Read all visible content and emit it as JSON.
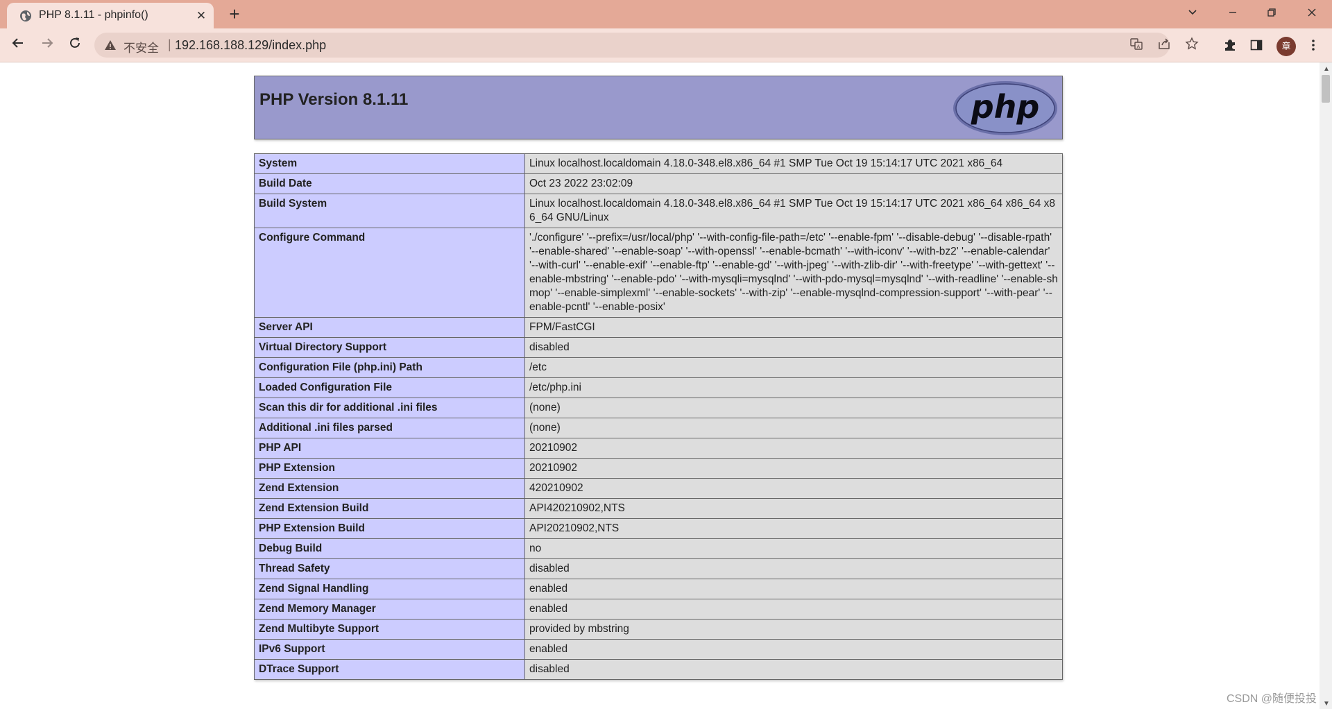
{
  "browser": {
    "tab_title": "PHP 8.1.11 - phpinfo()",
    "tab_close": "✕",
    "new_tab": "+",
    "insecure_label": "不安全",
    "separator": "|",
    "url": "192.168.188.129/index.php",
    "avatar_initial": "章",
    "icons": {
      "back": "back-arrow-icon",
      "forward": "forward-arrow-icon",
      "reload": "reload-icon",
      "translate": "translate-icon",
      "share": "share-icon",
      "bookmark": "star-icon",
      "extensions": "puzzle-icon",
      "sidebar": "sidebar-icon",
      "menu": "kebab-menu-icon"
    }
  },
  "page": {
    "title": "PHP Version 8.1.11",
    "rows": [
      {
        "key": "System",
        "value": "Linux localhost.localdomain 4.18.0-348.el8.x86_64 #1 SMP Tue Oct 19 15:14:17 UTC 2021 x86_64"
      },
      {
        "key": "Build Date",
        "value": "Oct 23 2022 23:02:09"
      },
      {
        "key": "Build System",
        "value": "Linux localhost.localdomain 4.18.0-348.el8.x86_64 #1 SMP Tue Oct 19 15:14:17 UTC 2021 x86_64 x86_64 x86_64 GNU/Linux"
      },
      {
        "key": "Configure Command",
        "value": "'./configure' '--prefix=/usr/local/php' '--with-config-file-path=/etc' '--enable-fpm' '--disable-debug' '--disable-rpath' '--enable-shared' '--enable-soap' '--with-openssl' '--enable-bcmath' '--with-iconv' '--with-bz2' '--enable-calendar' '--with-curl' '--enable-exif' '--enable-ftp' '--enable-gd' '--with-jpeg' '--with-zlib-dir' '--with-freetype' '--with-gettext' '--enable-mbstring' '--enable-pdo' '--with-mysqli=mysqlnd' '--with-pdo-mysql=mysqlnd' '--with-readline' '--enable-shmop' '--enable-simplexml' '--enable-sockets' '--with-zip' '--enable-mysqlnd-compression-support' '--with-pear' '--enable-pcntl' '--enable-posix'"
      },
      {
        "key": "Server API",
        "value": "FPM/FastCGI"
      },
      {
        "key": "Virtual Directory Support",
        "value": "disabled"
      },
      {
        "key": "Configuration File (php.ini) Path",
        "value": "/etc"
      },
      {
        "key": "Loaded Configuration File",
        "value": "/etc/php.ini"
      },
      {
        "key": "Scan this dir for additional .ini files",
        "value": "(none)"
      },
      {
        "key": "Additional .ini files parsed",
        "value": "(none)"
      },
      {
        "key": "PHP API",
        "value": "20210902"
      },
      {
        "key": "PHP Extension",
        "value": "20210902"
      },
      {
        "key": "Zend Extension",
        "value": "420210902"
      },
      {
        "key": "Zend Extension Build",
        "value": "API420210902,NTS"
      },
      {
        "key": "PHP Extension Build",
        "value": "API20210902,NTS"
      },
      {
        "key": "Debug Build",
        "value": "no"
      },
      {
        "key": "Thread Safety",
        "value": "disabled"
      },
      {
        "key": "Zend Signal Handling",
        "value": "enabled"
      },
      {
        "key": "Zend Memory Manager",
        "value": "enabled"
      },
      {
        "key": "Zend Multibyte Support",
        "value": "provided by mbstring"
      },
      {
        "key": "IPv6 Support",
        "value": "enabled"
      },
      {
        "key": "DTrace Support",
        "value": "disabled"
      }
    ]
  },
  "watermark": "CSDN @随便投投"
}
